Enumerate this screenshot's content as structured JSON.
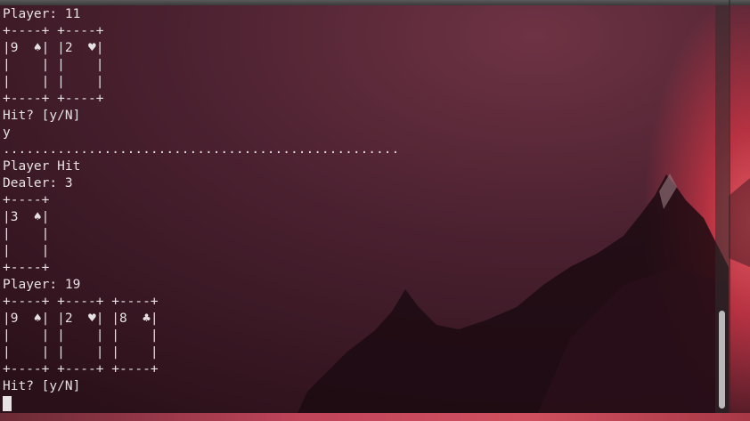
{
  "terminal": {
    "lines": [
      "Player: 11",
      "+----+ +----+",
      "|9  ♠| |2  ♥|",
      "|    | |    |",
      "|    | |    |",
      "+----+ +----+",
      "Hit? [y/N]",
      "y",
      "...................................................",
      "Player Hit",
      "Dealer: 3",
      "+----+",
      "|3  ♠|",
      "|    |",
      "|    |",
      "+----+",
      "Player: 19",
      "+----+ +----+ +----+",
      "|9  ♠| |2  ♥| |8  ♣|",
      "|    | |    | |    |",
      "|    | |    | |    |",
      "+----+ +----+ +----+",
      "Hit? [y/N]"
    ],
    "input_value": ""
  },
  "colors": {
    "text": "#e6e2e4",
    "wallpaper_accent": "#d0505f"
  },
  "icons": {
    "wallpaper": "mountain-landscape"
  }
}
